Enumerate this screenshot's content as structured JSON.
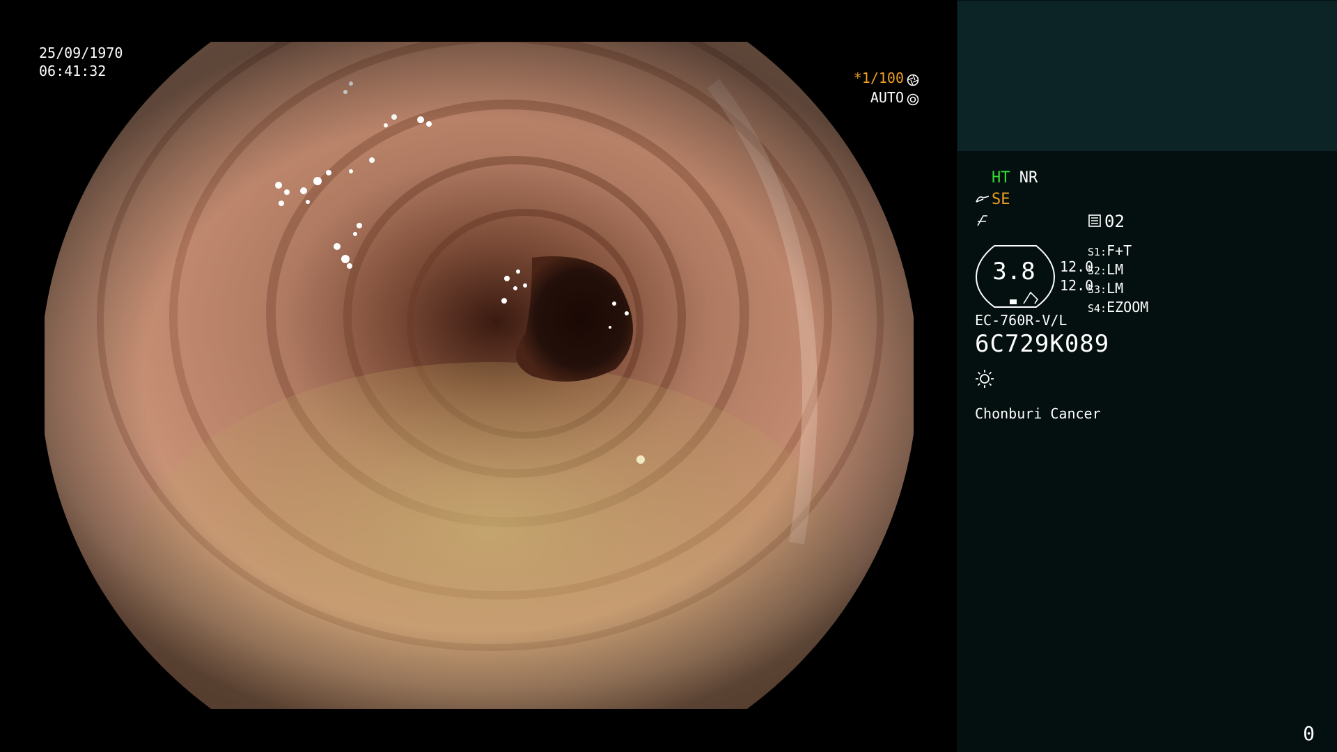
{
  "overlay": {
    "date": "25/09/1970",
    "time": "06:41:32",
    "shutter": "*1/100",
    "mode": "AUTO"
  },
  "panel": {
    "ht": "HT",
    "nr": "NR",
    "se": "SE",
    "channel": "02",
    "magnification": "3.8",
    "scale_top": "12.0",
    "scale_bottom": "12.0",
    "switches": [
      {
        "key": "S1:",
        "value": "F+T"
      },
      {
        "key": "S2:",
        "value": "LM"
      },
      {
        "key": "S3:",
        "value": "LM"
      },
      {
        "key": "S4:",
        "value": "EZOOM"
      }
    ],
    "scope_model": "EC-760R-V/L",
    "serial": "6C729K089",
    "institution": "Chonburi Cancer",
    "page_number": "0"
  },
  "colors": {
    "ht": "#33dd33",
    "se": "#f0a020",
    "panel_header": "#0d2426",
    "panel_body": "#03100f"
  },
  "icons": [
    "aperture-icon",
    "auto-iris-icon",
    "scissors-icon",
    "no-freeze-icon",
    "memo-icon",
    "light-icon"
  ]
}
